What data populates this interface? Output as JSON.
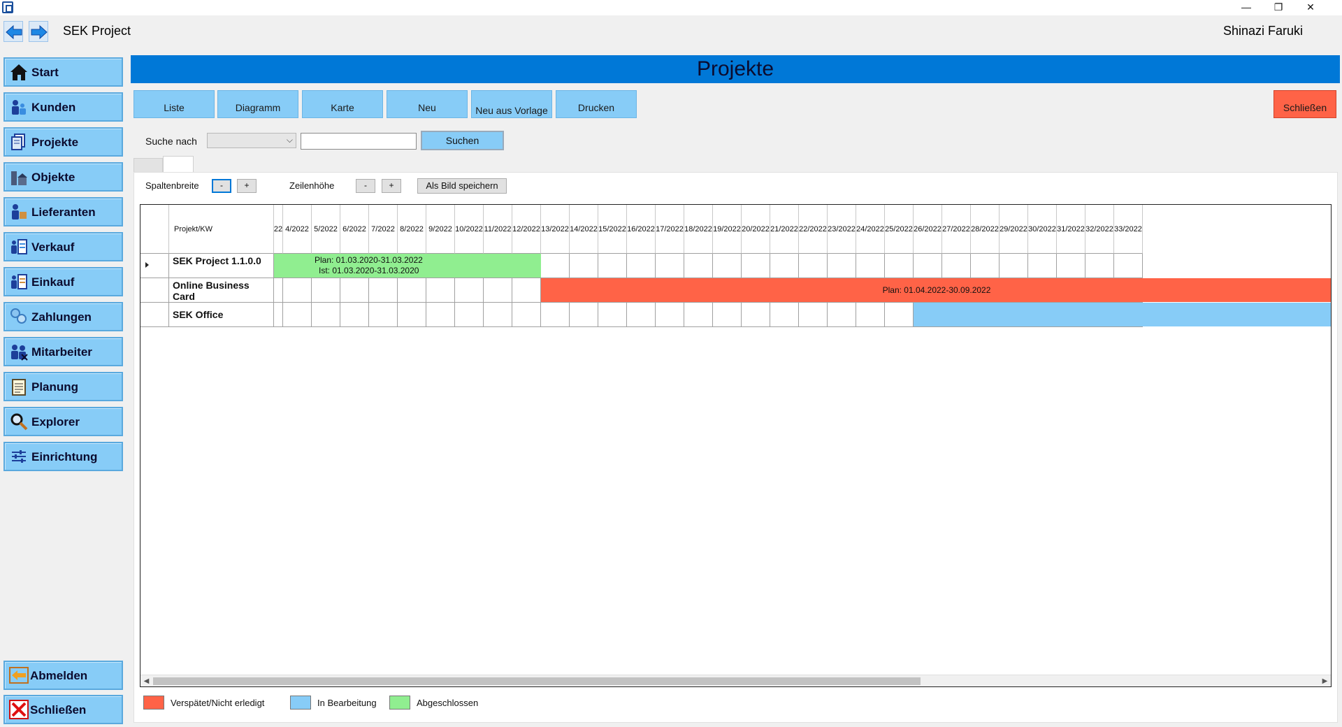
{
  "window": {
    "minimize": "—",
    "restore": "❐",
    "close": "✕"
  },
  "header": {
    "app_title": "SEK Project",
    "user_name": "Shinazi Faruki"
  },
  "sidebar": {
    "items": [
      {
        "label": "Start",
        "icon": "house-icon"
      },
      {
        "label": "Kunden",
        "icon": "customers-icon"
      },
      {
        "label": "Projekte",
        "icon": "projects-icon"
      },
      {
        "label": "Objekte",
        "icon": "objects-icon"
      },
      {
        "label": "Lieferanten",
        "icon": "suppliers-icon"
      },
      {
        "label": "Verkauf",
        "icon": "sales-icon"
      },
      {
        "label": "Einkauf",
        "icon": "purchase-icon"
      },
      {
        "label": "Zahlungen",
        "icon": "payments-icon"
      },
      {
        "label": "Mitarbeiter",
        "icon": "employees-icon"
      },
      {
        "label": "Planung",
        "icon": "planning-icon"
      },
      {
        "label": "Explorer",
        "icon": "magnifier-icon"
      },
      {
        "label": "Einrichtung",
        "icon": "settings-sliders-icon"
      }
    ],
    "bottom": [
      {
        "label": "Abmelden",
        "icon": "logout-arrow-icon"
      },
      {
        "label": "Schließen",
        "icon": "close-x-icon"
      }
    ]
  },
  "main": {
    "title": "Projekte",
    "toolbar": {
      "liste": "Liste",
      "diagramm": "Diagramm",
      "karte": "Karte",
      "neu": "Neu",
      "neu_aus_vorlage": "Neu aus Vorlage",
      "drucken": "Drucken",
      "schliessen": "Schließen"
    },
    "search": {
      "label": "Suche nach",
      "dropdown_value": "",
      "input_value": "",
      "button": "Suchen"
    },
    "controls": {
      "spaltenbreite": "Spaltenbreite",
      "zeilenhoehe": "Zeilenhöhe",
      "minus": "-",
      "plus": "+",
      "save_image": "Als Bild speichern"
    },
    "gantt": {
      "header_label": "Projekt/KW",
      "weeks": [
        "22",
        "4/2022",
        "5/2022",
        "6/2022",
        "7/2022",
        "8/2022",
        "9/2022",
        "10/2022",
        "11/2022",
        "12/2022",
        "13/2022",
        "14/2022",
        "15/2022",
        "16/2022",
        "17/2022",
        "18/2022",
        "19/2022",
        "20/2022",
        "21/2022",
        "22/2022",
        "23/2022",
        "24/2022",
        "25/2022",
        "26/2022",
        "27/2022",
        "28/2022",
        "29/2022",
        "30/2022",
        "31/2022",
        "32/2022",
        "33/2022"
      ],
      "rows": [
        {
          "name": "SEK Project 1.1.0.0",
          "status": "Abgeschlossen",
          "bar_start_week": 0,
          "bar_end_week": 10,
          "label_line1": "Plan: 01.03.2020-31.03.2022",
          "label_line2": "Ist: 01.03.2020-31.03.2020"
        },
        {
          "name": "Online Business Card",
          "status": "Verspätet/Nicht erledigt",
          "bar_start_week": 10,
          "bar_end_week": 31,
          "label_line1": "Plan: 01.04.2022-30.09.2022",
          "label_line2": ""
        },
        {
          "name": "SEK Office",
          "status": "In Bearbeitung",
          "bar_start_week": 23,
          "bar_end_week": 31,
          "label_line1": "",
          "label_line2": ""
        }
      ]
    },
    "legend": [
      {
        "label": "Verspätet/Nicht erledigt",
        "color": "#ff6347"
      },
      {
        "label": "In Bearbeitung",
        "color": "#87ccf7"
      },
      {
        "label": "Abgeschlossen",
        "color": "#90ee90"
      }
    ]
  },
  "colors": {
    "banner": "#0078d7",
    "button": "#87ccf7",
    "close": "#ff6347",
    "done": "#90ee90"
  }
}
